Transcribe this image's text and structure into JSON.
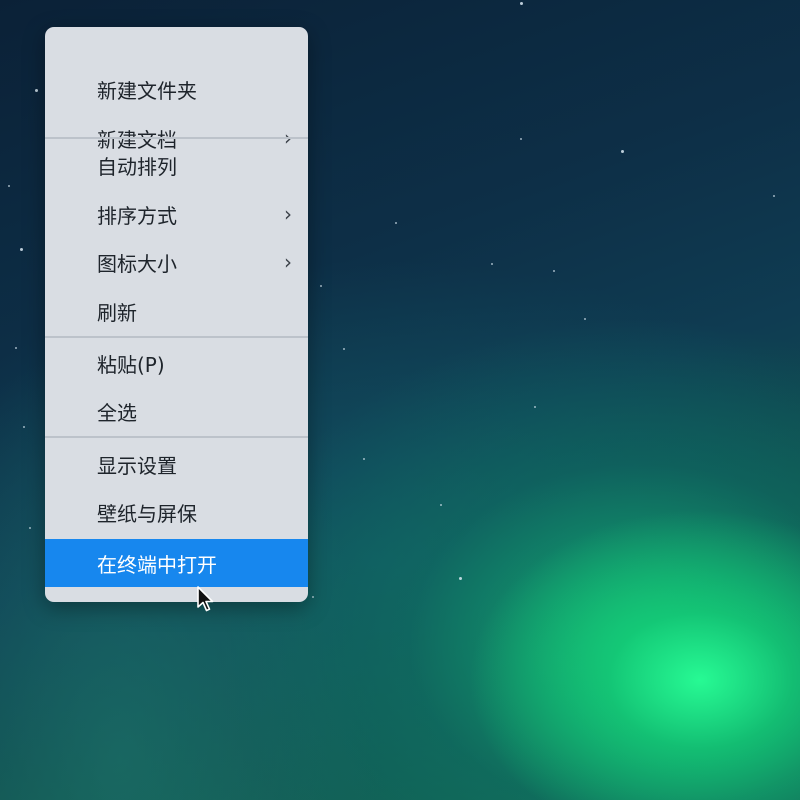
{
  "context_menu": {
    "items": [
      {
        "label": "新建文件夹",
        "has_submenu": false
      },
      {
        "label": "新建文档",
        "has_submenu": true,
        "chevron": "›"
      },
      {
        "label": "自动排列",
        "has_submenu": false
      },
      {
        "label": "排序方式",
        "has_submenu": true,
        "chevron": "›"
      },
      {
        "label": "图标大小",
        "has_submenu": true,
        "chevron": "›"
      },
      {
        "label": "刷新",
        "has_submenu": false
      },
      {
        "label": "粘贴(P)",
        "has_submenu": false
      },
      {
        "label": "全选",
        "has_submenu": false
      },
      {
        "label": "显示设置",
        "has_submenu": false
      },
      {
        "label": "壁纸与屏保",
        "has_submenu": false
      },
      {
        "label": "在终端中打开",
        "has_submenu": false,
        "highlighted": true
      }
    ]
  },
  "colors": {
    "menu_background": "#d9dde3",
    "highlight": "#1787ee",
    "text": "#1e242b",
    "aurora_green": "#28ff96"
  },
  "icons": {
    "submenu": "chevron-right-icon",
    "pointer": "mouse-pointer-icon"
  }
}
